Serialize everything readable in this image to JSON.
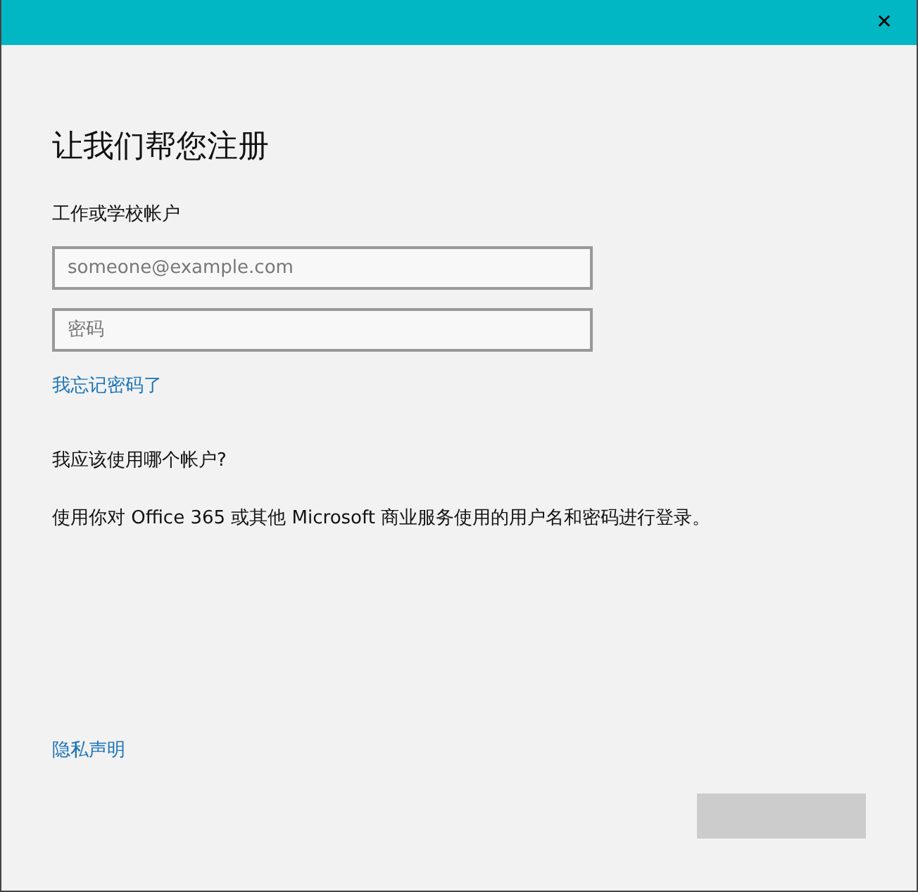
{
  "window": {
    "close_glyph": "✕"
  },
  "title": "让我们帮您注册",
  "account_label": "工作或学校帐户",
  "email_field": {
    "placeholder": "someone@example.com"
  },
  "password_field": {
    "placeholder": "密码"
  },
  "forgot_link": "我忘记密码了",
  "help_heading": "我应该使用哪个帐户?",
  "help_text": "使用你对 Office 365 或其他 Microsoft 商业服务使用的用户名和密码进行登录。",
  "privacy_link": "隐私声明",
  "next_button": {
    "disabled": true
  }
}
